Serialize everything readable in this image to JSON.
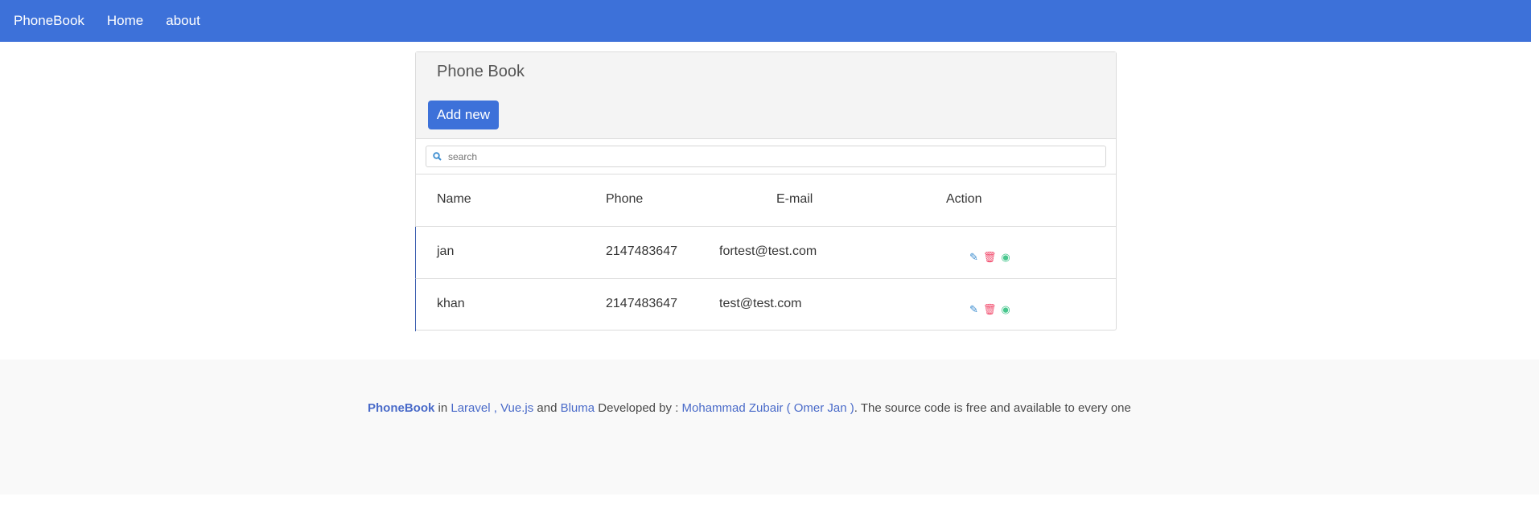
{
  "nav": {
    "brand": "PhoneBook",
    "items": [
      "Home",
      "about"
    ]
  },
  "card": {
    "title": "Phone Book",
    "add_label": "Add new",
    "search_placeholder": "search",
    "columns": [
      "Name",
      "Phone",
      "E-mail",
      "Action"
    ],
    "rows": [
      {
        "name": "jan",
        "phone": "2147483647",
        "email": "fortest@test.com"
      },
      {
        "name": "khan",
        "phone": "2147483647",
        "email": "test@test.com"
      }
    ]
  },
  "footer": {
    "brand": "PhoneBook",
    "in": " in ",
    "laravel": "Laravel ,",
    "vue": "Vue.js",
    "and": " and ",
    "bluma": "Bluma",
    "dev": " Developed by : ",
    "author": "Mohammad Zubair ( Omer Jan )",
    "rest": ". The source code is free and available to every one"
  },
  "colors": {
    "primary": "#3d71d9",
    "edit": "#3e8ed0",
    "delete": "#f14668",
    "view": "#48c78e"
  }
}
